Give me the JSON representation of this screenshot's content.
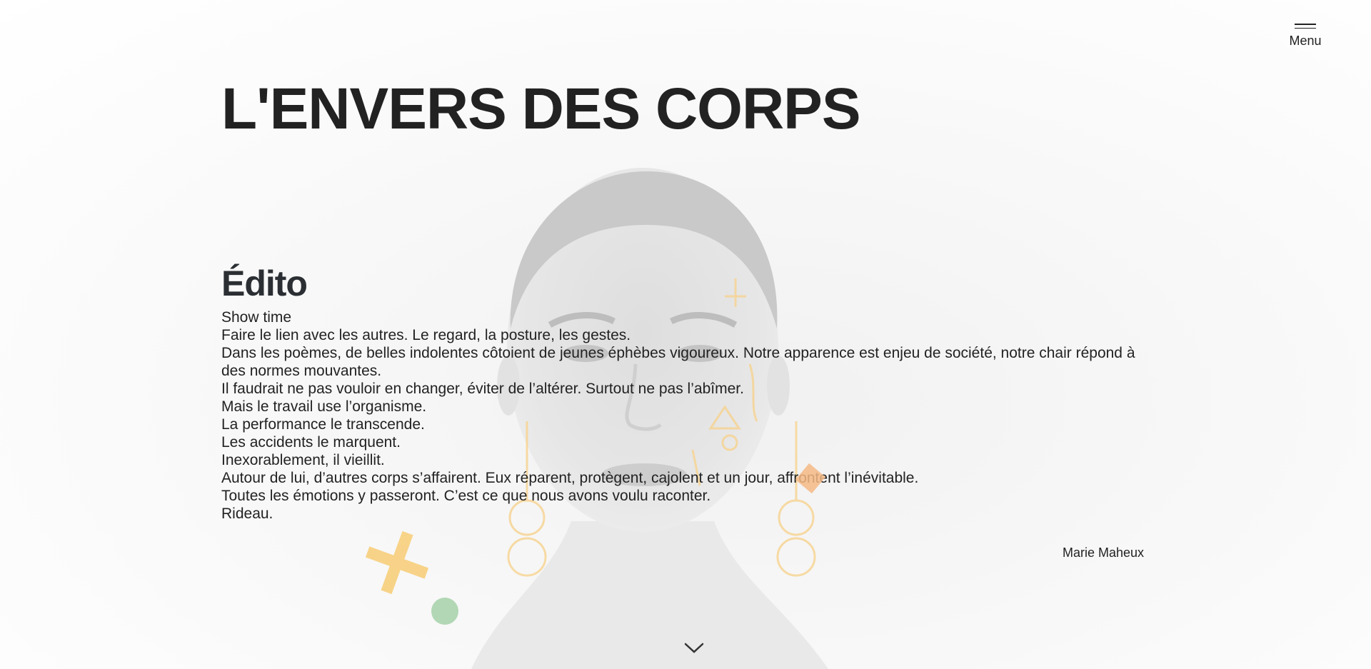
{
  "header": {
    "menu_label": "Menu",
    "menu_icon": "hamburger-icon"
  },
  "hero": {
    "title": "L'ENVERS DES CORPS"
  },
  "edito": {
    "heading": "Édito",
    "lines": [
      "Show time",
      "Faire le lien avec les autres. Le regard, la posture, les gestes.",
      "Dans les poèmes, de belles indolentes côtoient de jeunes éphèbes vigoureux. Notre apparence est enjeu de société, notre chair répond à des normes mouvantes.",
      "Il faudrait ne pas vouloir en changer, éviter de l’altérer. Surtout ne pas l’abîmer.",
      "Mais le travail use l’organisme.",
      "La performance le transcende.",
      "Les accidents le marquent.",
      "Inexorablement, il vieillit.",
      "Autour de lui, d’autres corps s’affairent. Eux réparent, protègent, cajolent et un jour, affrontent l’inévitable.",
      "Toutes les émotions y passeront. C’est ce que nous avons voulu raconter.",
      "Rideau."
    ],
    "signature": "Marie Maheux"
  },
  "scroll": {
    "icon": "chevron-down-icon"
  },
  "colors": {
    "title": "#222222",
    "accent_yellow": "#f7cf7c",
    "accent_green": "#a9d3ac",
    "accent_orange": "#f4b985"
  }
}
